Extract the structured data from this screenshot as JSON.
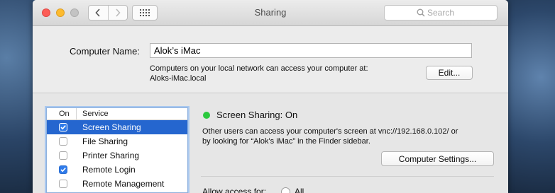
{
  "window": {
    "title": "Sharing",
    "search_placeholder": "Search"
  },
  "computer_name": {
    "label": "Computer Name:",
    "value": "Alok’s iMac",
    "info_line1": "Computers on your local network can access your computer at:",
    "info_line2": "Aloks-iMac.local",
    "edit_button": "Edit..."
  },
  "services": {
    "header_on": "On",
    "header_service": "Service",
    "items": [
      {
        "label": "Screen Sharing",
        "checked": true,
        "selected": true
      },
      {
        "label": "File Sharing",
        "checked": false,
        "selected": false
      },
      {
        "label": "Printer Sharing",
        "checked": false,
        "selected": false
      },
      {
        "label": "Remote Login",
        "checked": true,
        "selected": false
      },
      {
        "label": "Remote Management",
        "checked": false,
        "selected": false
      }
    ]
  },
  "detail": {
    "status": "Screen Sharing: On",
    "status_color": "#2bc93e",
    "desc_line1": "Other users can access your computer's screen at vnc://192.168.0.102/ or",
    "desc_line2": "by looking for “Alok's iMac” in the Finder sidebar.",
    "settings_button": "Computer Settings...",
    "access_label": "Allow access for:",
    "radio_all": "All"
  },
  "colors": {
    "selection": "#2566cf",
    "checkbox_on": "#2f7bea"
  }
}
